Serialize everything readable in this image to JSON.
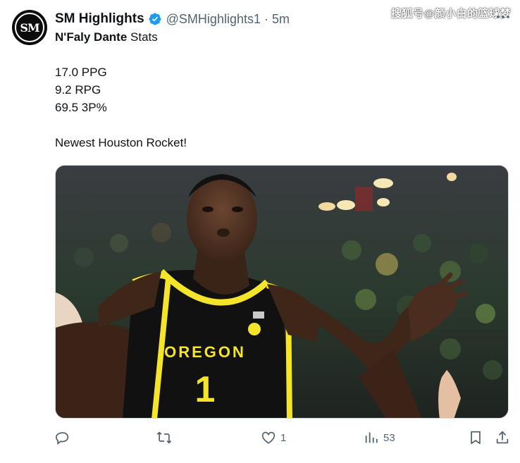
{
  "tweet": {
    "display_name": "SM Highlights",
    "handle": "@SMHighlights1",
    "separator": "·",
    "time": "5m",
    "avatar_text": "SM",
    "verified": true,
    "lines": {
      "title_bold": "N'Faly Dante",
      "title_rest": " Stats",
      "stat1": "17.0 PPG",
      "stat2": "9.2 RPG",
      "stat3": "69.5 3P%",
      "closing": "Newest Houston Rocket!"
    },
    "media": {
      "jersey_text": "OREGON",
      "jersey_number": "1"
    },
    "actions": {
      "reply_count": "",
      "retweet_count": "",
      "like_count": "1",
      "views_count": "53"
    }
  },
  "watermark": "搜狐号@颜小白的篮球梦",
  "colors": {
    "verified": "#1d9bf0",
    "text": "#0f1419",
    "secondary": "#536471",
    "jersey_yellow": "#f4e52a",
    "jersey_black": "#111111"
  },
  "icons": [
    "more-icon",
    "verified-badge-icon",
    "reply-icon",
    "retweet-icon",
    "like-icon",
    "views-icon",
    "bookmark-icon",
    "share-icon"
  ]
}
